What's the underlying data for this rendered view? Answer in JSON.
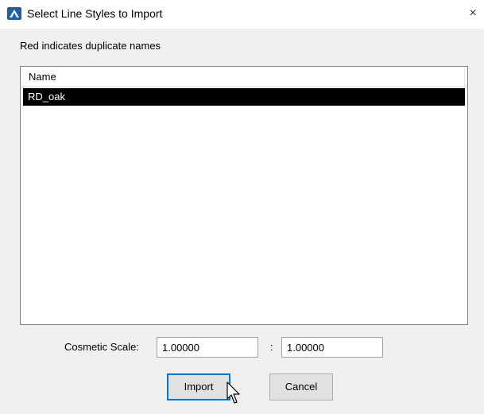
{
  "window": {
    "title": "Select Line Styles to Import",
    "close_glyph": "×"
  },
  "hint": "Red indicates duplicate names",
  "list": {
    "columns": [
      "Name"
    ],
    "rows": [
      {
        "name": "RD_oak",
        "selected": true
      }
    ]
  },
  "scale": {
    "label": "Cosmetic Scale:",
    "value_1": "1.00000",
    "separator": ":",
    "value_2": "1.00000"
  },
  "buttons": {
    "import": "Import",
    "cancel": "Cancel"
  },
  "icons": {
    "app": "microstation-app-icon",
    "close": "close-icon",
    "cursor": "mouse-pointer-icon"
  },
  "colors": {
    "selection_bg": "#000000",
    "selection_text": "#ffffff",
    "focus_border": "#0078d7",
    "app_icon_blue": "#1e5fa8"
  }
}
